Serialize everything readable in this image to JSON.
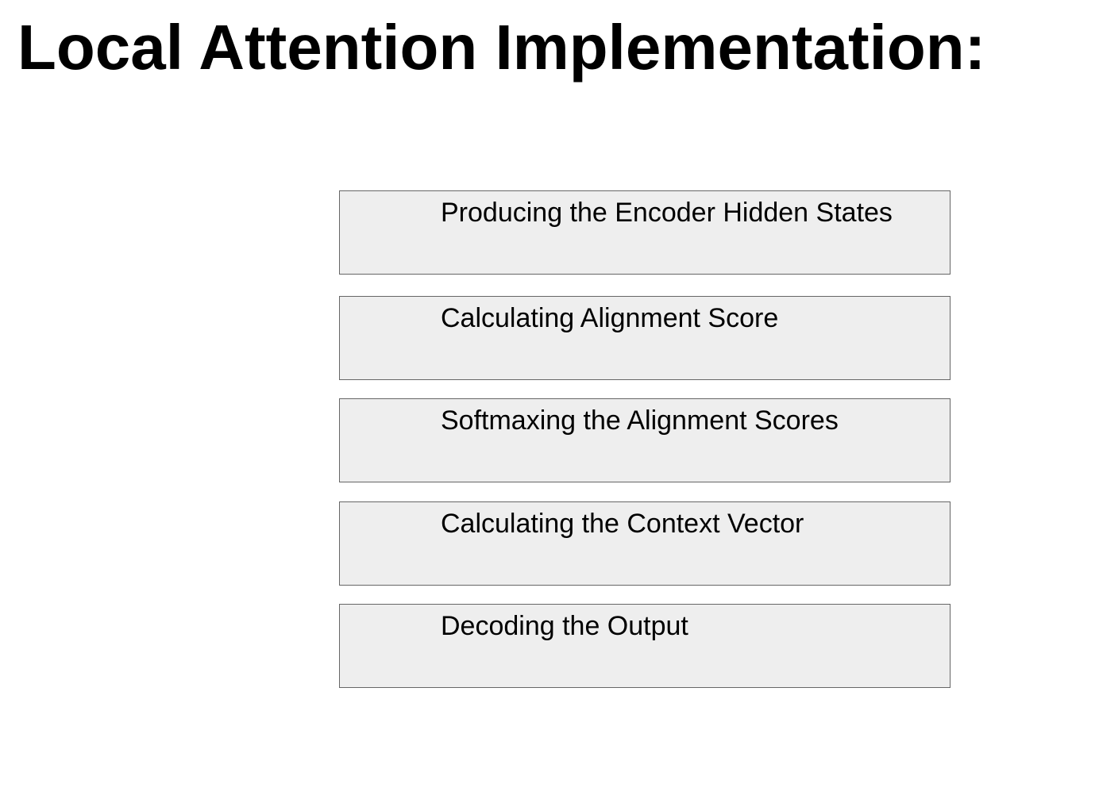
{
  "title": "Local Attention Implementation:",
  "steps": [
    {
      "label": "Producing the Encoder Hidden States"
    },
    {
      "label": "Calculating Alignment Score"
    },
    {
      "label": "Softmaxing the Alignment Scores"
    },
    {
      "label": "Calculating the Context Vector"
    },
    {
      "label": "Decoding the Output"
    }
  ]
}
